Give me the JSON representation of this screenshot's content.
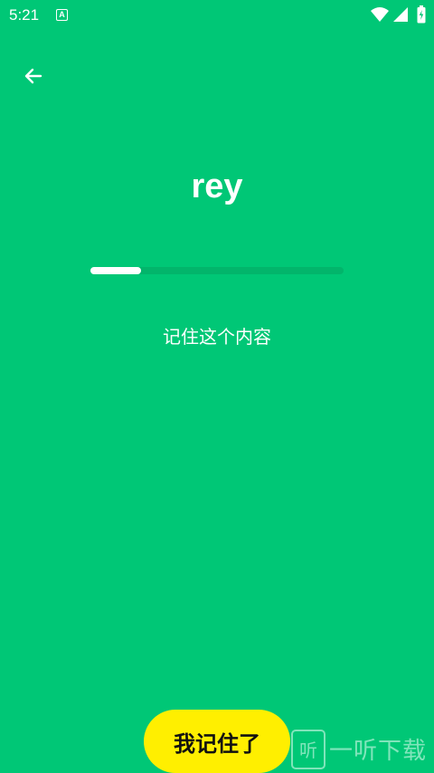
{
  "status_bar": {
    "time": "5:21",
    "notification_icon_letter": "A",
    "icons": [
      "wifi-icon",
      "signal-icon",
      "battery-icon"
    ]
  },
  "back": {
    "icon": "arrow-left-icon"
  },
  "word": {
    "text": "rey"
  },
  "progress": {
    "fraction": 0.2
  },
  "hint": {
    "text": "记住这个内容"
  },
  "actions": {
    "remember_label": "我记住了"
  },
  "watermark": {
    "logo_text": "听",
    "text": "一听下载"
  },
  "colors": {
    "background": "#00C776",
    "button": "#FFEF00",
    "track": "#02B56B",
    "fill": "#FFFFFF"
  }
}
